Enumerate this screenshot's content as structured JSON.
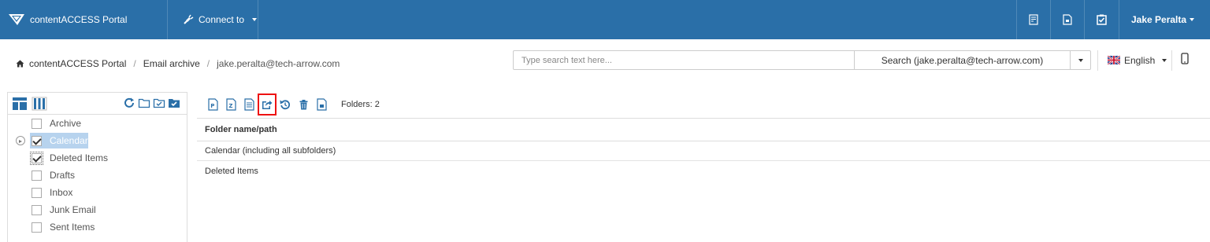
{
  "topnav": {
    "app_name": "contentACCESS Portal",
    "connect_label": "Connect to",
    "icons": [
      "report-icon",
      "document-icon",
      "tasks-icon"
    ],
    "user_name": "Jake Peralta",
    "background": "#2a6fa8"
  },
  "breadcrumb": {
    "items": [
      "contentACCESS Portal",
      "Email archive",
      "jake.peralta@tech-arrow.com"
    ]
  },
  "search": {
    "placeholder": "Type search text here...",
    "button_label": "Search (jake.peralta@tech-arrow.com)"
  },
  "language": {
    "label": "English"
  },
  "tree": {
    "items": [
      {
        "label": "Archive",
        "checked": false
      },
      {
        "label": "Calendar",
        "checked": true,
        "selected": true,
        "expandable": true
      },
      {
        "label": "Deleted Items",
        "checked": true
      },
      {
        "label": "Drafts",
        "checked": false
      },
      {
        "label": "Inbox",
        "checked": false
      },
      {
        "label": "Junk Email",
        "checked": false
      },
      {
        "label": "Sent Items",
        "checked": false
      }
    ]
  },
  "toolbar": {
    "icons": [
      "pdf-export-icon",
      "zip-export-icon",
      "list-icon",
      "share-export-icon",
      "restore-icon",
      "delete-icon",
      "file-icon"
    ],
    "highlighted": "share-export-icon",
    "folders_count": "Folders: 2"
  },
  "table": {
    "header": "Folder name/path",
    "rows": [
      "Calendar (including all subfolders)",
      "Deleted Items"
    ]
  },
  "colors": {
    "accent": "#2a6fa8",
    "highlight": "#e11111",
    "selection": "#b7d3ee"
  }
}
